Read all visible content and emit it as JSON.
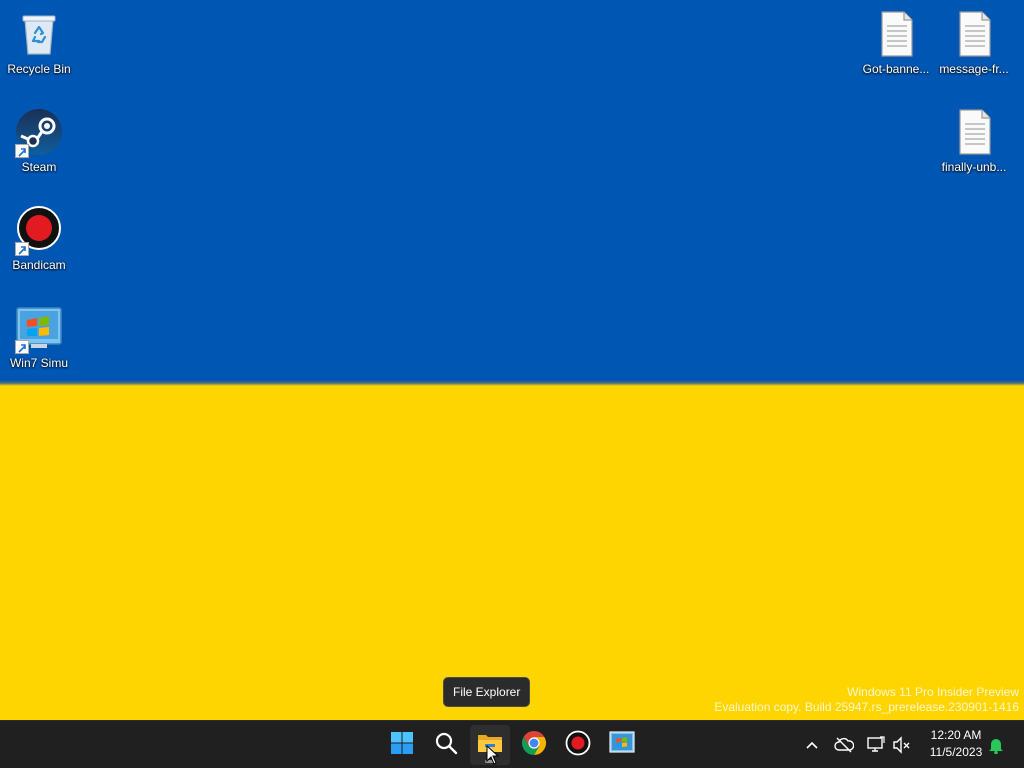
{
  "desktop": {
    "wallpaper": {
      "top_color": "#0056b3",
      "bottom_color": "#ffd500"
    },
    "left_icons": [
      {
        "label": "Recycle Bin",
        "icon": "recycle-bin-icon"
      },
      {
        "label": "Steam",
        "icon": "steam-icon"
      },
      {
        "label": "Bandicam",
        "icon": "bandicam-icon"
      },
      {
        "label": "Win7 Simu",
        "icon": "win7-simu-icon"
      }
    ],
    "right_icons": [
      {
        "label": "Got-banne...",
        "icon": "text-file-icon"
      },
      {
        "label": "message-fr...",
        "icon": "text-file-icon"
      },
      {
        "label": "finally-unb...",
        "icon": "text-file-icon"
      }
    ],
    "watermark": {
      "line1": "Windows 11 Pro Insider Preview",
      "line2": "Evaluation copy. Build 25947.rs_prerelease.230901-1416"
    }
  },
  "tooltip": {
    "text": "File Explorer"
  },
  "taskbar": {
    "apps": [
      {
        "name": "Start",
        "icon": "windows-start-icon"
      },
      {
        "name": "Search",
        "icon": "search-icon"
      },
      {
        "name": "File Explorer",
        "icon": "folder-icon",
        "active": true
      },
      {
        "name": "Google Chrome",
        "icon": "chrome-icon"
      },
      {
        "name": "Bandicam",
        "icon": "bandicam-record-icon"
      },
      {
        "name": "Win7 Simu",
        "icon": "win7-simu-icon"
      }
    ],
    "tray": [
      "chevron-up-icon",
      "cloud-offline-icon",
      "network-icon",
      "volume-muted-icon",
      "notification-bell-icon"
    ],
    "clock": {
      "time": "12:20 AM",
      "date": "11/5/2023"
    }
  }
}
